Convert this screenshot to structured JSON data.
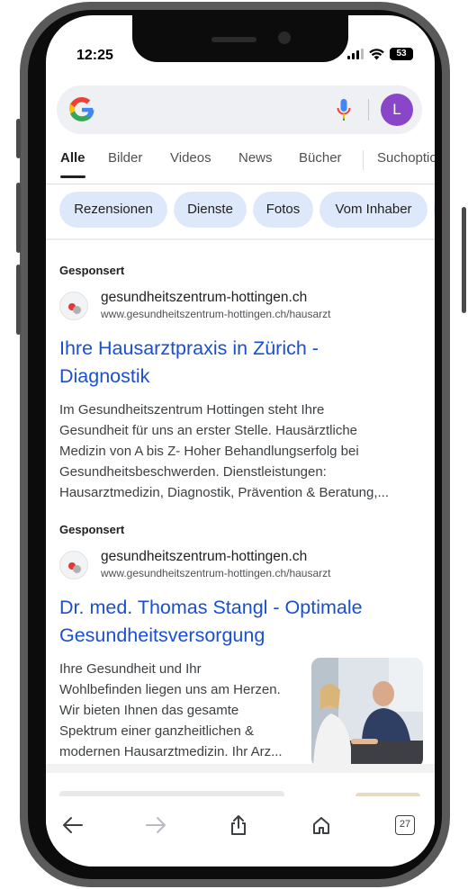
{
  "status_bar": {
    "time": "12:25",
    "battery": "53"
  },
  "search": {
    "avatar_letter": "L"
  },
  "tabs": [
    "Alle",
    "Bilder",
    "Videos",
    "News",
    "Bücher",
    "Suchoptionen"
  ],
  "chips": [
    "Rezensionen",
    "Dienste",
    "Fotos",
    "Vom Inhaber"
  ],
  "ads": [
    {
      "sponsored": "Gesponsert",
      "domain": "gesundheitszentrum-hottingen.ch",
      "url": "www.gesundheitszentrum-hottingen.ch/hausarzt",
      "title_line1": "Ihre Hausarztpraxis in Zürich -",
      "title_line2": "Diagnostik",
      "desc": [
        "Im Gesundheitszentrum Hottingen steht Ihre",
        "Gesundheit für uns an erster Stelle. Hausärztliche",
        "Medizin von A bis Z- Hoher Behandlungserfolg bei",
        "Gesundheitsbeschwerden. Dienstleistungen:",
        "Hausarztmedizin, Diagnostik, Prävention & Beratung,..."
      ]
    },
    {
      "sponsored": "Gesponsert",
      "domain": "gesundheitszentrum-hottingen.ch",
      "url": "www.gesundheitszentrum-hottingen.ch/hausarzt",
      "title_line1": "Dr. med. Thomas Stangl - Optimale",
      "title_line2": "Gesundheitsversorgung",
      "desc": [
        "Ihre Gesundheit und Ihr",
        "Wohlbefinden liegen uns am Herzen.",
        "Wir bieten Ihnen das gesamte",
        "Spektrum einer ganzheitlichen &",
        "modernen Hausarztmedizin. Ihr Arz..."
      ]
    }
  ],
  "toolbar": {
    "tab_count": "27"
  },
  "colors": {
    "link": "#1a4fd0",
    "chip_bg": "#dde9fb",
    "avatar": "#8a46c8"
  }
}
